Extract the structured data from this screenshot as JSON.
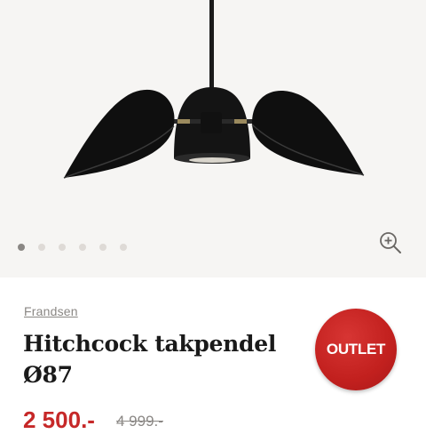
{
  "gallery": {
    "dots_count": 6,
    "active_index": 0,
    "zoom_icon": "zoom-in-icon"
  },
  "product": {
    "brand": "Frandsen",
    "title_line1": "Hitchcock takpendel",
    "title_line2": "Ø87",
    "badge": "OUTLET",
    "price": "2 500.-",
    "old_price": "4 999.-"
  },
  "colors": {
    "badge": "#c2201e",
    "price": "#c62828",
    "gallery_bg": "#f6f5f3"
  }
}
